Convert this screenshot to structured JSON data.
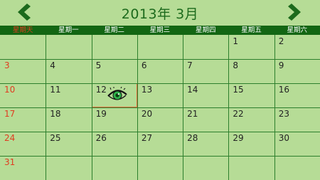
{
  "calendar": {
    "title": "2013年  3月",
    "weekdays": [
      "星期天",
      "星期一",
      "星期二",
      "星期三",
      "星期四",
      "星期五",
      "星期六"
    ],
    "weeks": [
      [
        "",
        "",
        "",
        "",
        "",
        "1",
        "2"
      ],
      [
        "3",
        "4",
        "5",
        "6",
        "7",
        "8",
        "9"
      ],
      [
        "10",
        "11",
        "12",
        "13",
        "14",
        "15",
        "16"
      ],
      [
        "17",
        "18",
        "19",
        "20",
        "21",
        "22",
        "23"
      ],
      [
        "24",
        "25",
        "26",
        "27",
        "28",
        "29",
        "30"
      ],
      [
        "31",
        "",
        "",
        "",
        "",
        "",
        ""
      ]
    ],
    "selected_day": "12",
    "selected_marker_icon": "eye-icon"
  },
  "colors": {
    "background": "#b6dc96",
    "header_bar": "#136613",
    "title_text": "#1c6a1c",
    "sunday_text": "#e03c20",
    "grid_lines": "#2d7f2d",
    "selection_border": "#e36a3a"
  }
}
